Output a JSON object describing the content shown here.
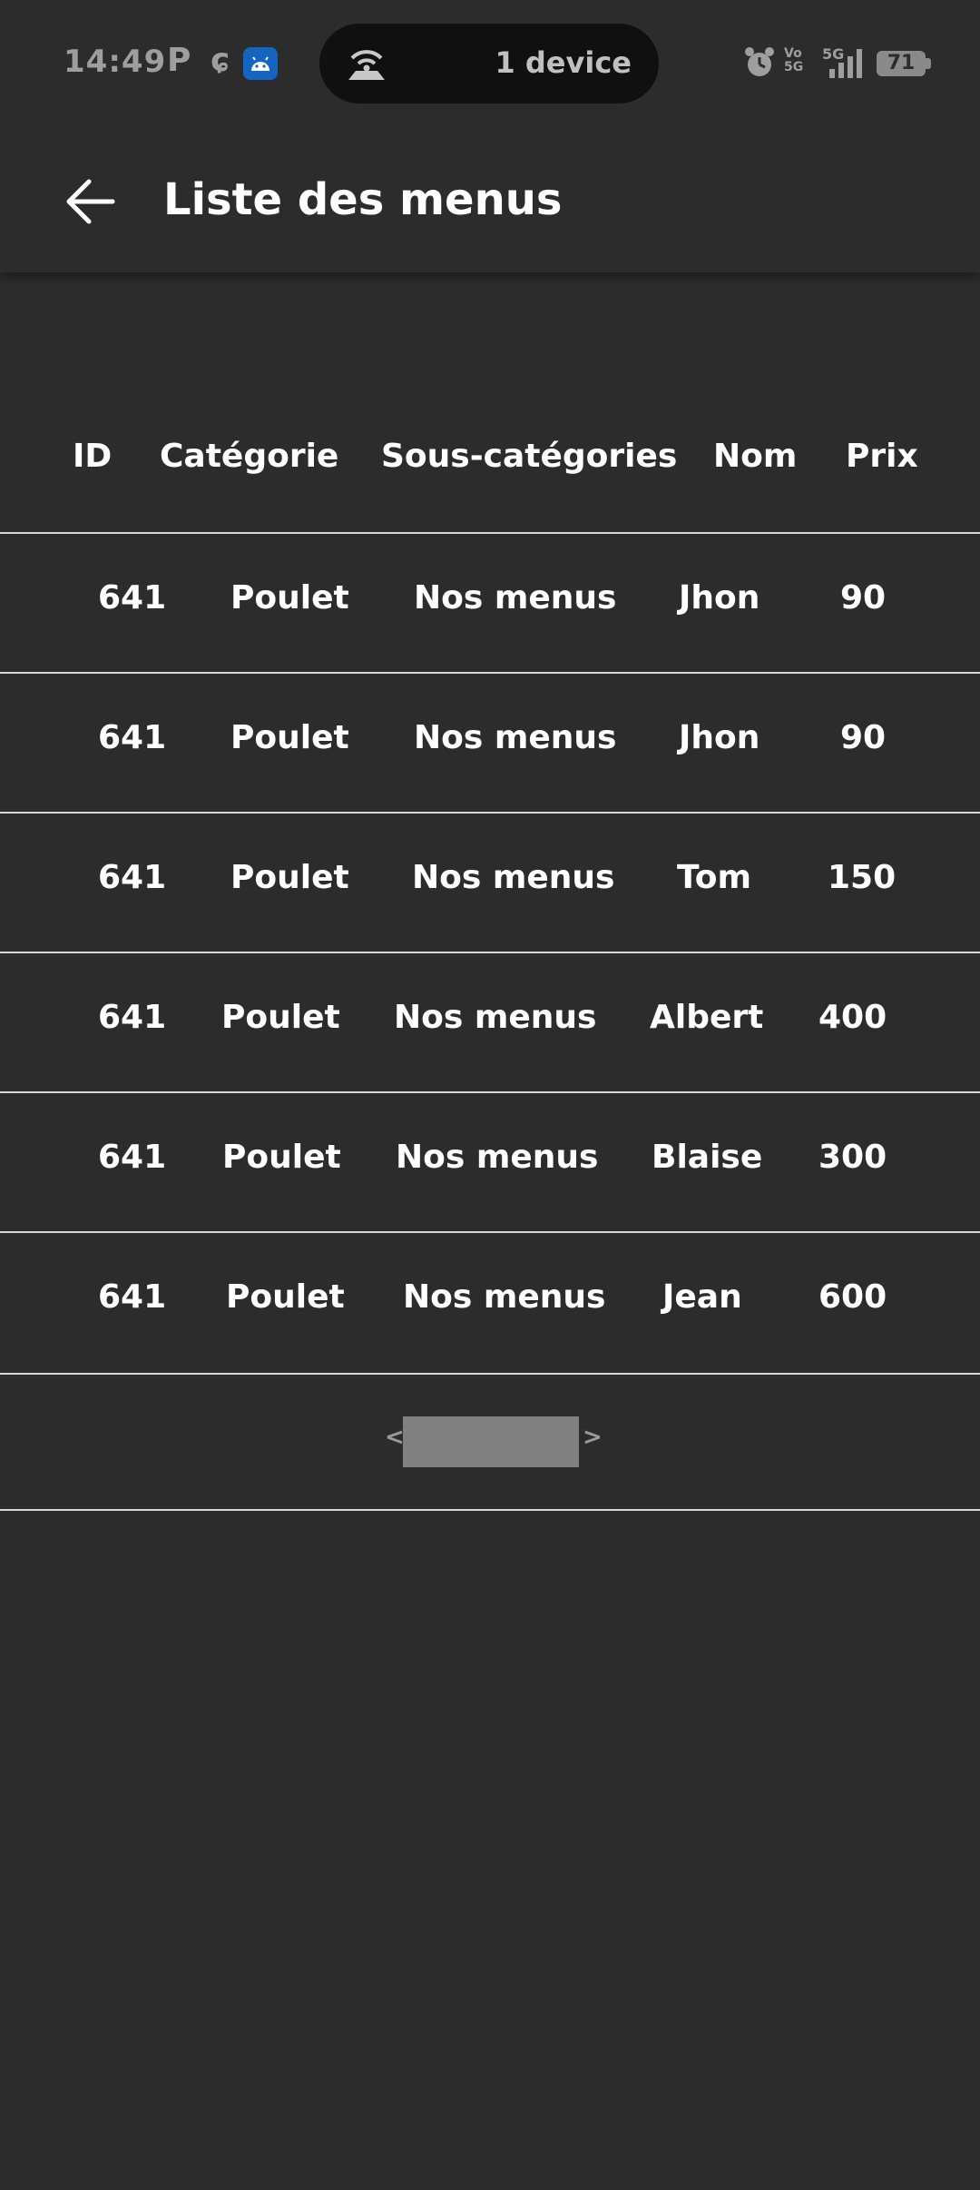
{
  "status_bar": {
    "time": "14:49",
    "notif_p": "P",
    "notif_k": "ɕ",
    "hotspot_text": "1 device",
    "volte_top": "Vo",
    "volte_bottom": "5G",
    "net_label": "5G",
    "battery": "71"
  },
  "app_bar": {
    "title": "Liste des menus"
  },
  "table": {
    "headers": [
      "ID",
      "Catégorie",
      "Sous-catégories",
      "Nom",
      "Prix"
    ],
    "rows": [
      [
        "641",
        "Poulet",
        "Nos menus",
        "Jhon",
        "90"
      ],
      [
        "641",
        "Poulet",
        "Nos menus",
        "Jhon",
        "90"
      ],
      [
        "641",
        "Poulet",
        "Nos menus",
        "Tom",
        "150"
      ],
      [
        "641",
        "Poulet",
        "Nos menus",
        "Albert",
        "400"
      ],
      [
        "641",
        "Poulet",
        "Nos menus",
        "Blaise",
        "300"
      ],
      [
        "641",
        "Poulet",
        "Nos menus",
        "Jean",
        "600"
      ]
    ]
  },
  "pagination": {
    "prev_label": "<",
    "next_label": ">"
  },
  "colors": {
    "background": "#2c2c2c",
    "text": "#ffffff",
    "divider": "#d8d8d8"
  }
}
